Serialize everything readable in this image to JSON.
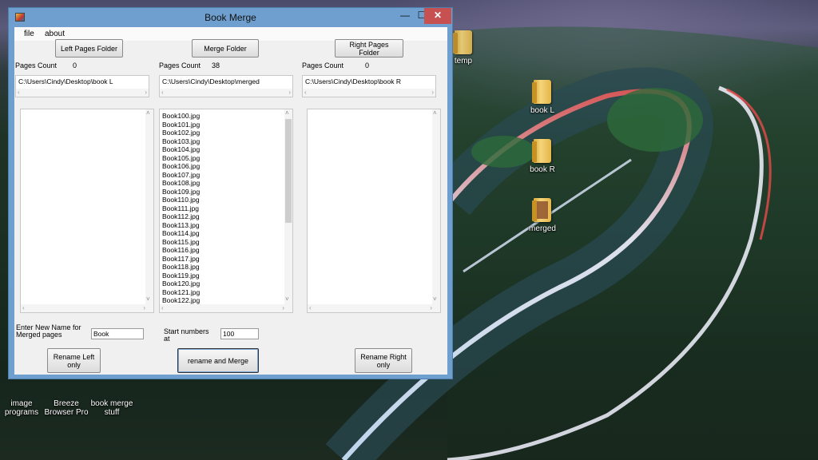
{
  "window": {
    "title": "Book Merge",
    "controls": {
      "minimize": "—",
      "maximize": "☐",
      "close": "✕"
    }
  },
  "menu": {
    "items": [
      "file",
      "about"
    ]
  },
  "buttons": {
    "left_folder": "Left Pages Folder",
    "merge_folder": "Merge Folder",
    "right_folder": "Right Pages Folder",
    "rename_left": "Rename Left only",
    "rename_merge": "rename and Merge",
    "rename_right": "Rename Right only"
  },
  "columns": {
    "left": {
      "count_label": "Pages Count",
      "count": "0",
      "path": "C:\\Users\\Cindy\\Desktop\\book L",
      "files": []
    },
    "merge": {
      "count_label": "Pages Count",
      "count": "38",
      "path": "C:\\Users\\Cindy\\Desktop\\merged",
      "files": [
        "Book100.jpg",
        "Book101.jpg",
        "Book102.jpg",
        "Book103.jpg",
        "Book104.jpg",
        "Book105.jpg",
        "Book106.jpg",
        "Book107.jpg",
        "Book108.jpg",
        "Book109.jpg",
        "Book110.jpg",
        "Book111.jpg",
        "Book112.jpg",
        "Book113.jpg",
        "Book114.jpg",
        "Book115.jpg",
        "Book116.jpg",
        "Book117.jpg",
        "Book118.jpg",
        "Book119.jpg",
        "Book120.jpg",
        "Book121.jpg",
        "Book122.jpg"
      ]
    },
    "right": {
      "count_label": "Pages Count",
      "count": "0",
      "path": "C:\\Users\\Cindy\\Desktop\\book R",
      "files": []
    }
  },
  "rename": {
    "name_label": "Enter New Name for Merged pages",
    "name_value": "Book",
    "start_label": "Start numbers at",
    "start_value": "100"
  },
  "desktop": {
    "icons": [
      {
        "label": "temp",
        "icon": "folder-icon"
      },
      {
        "label": "book L",
        "icon": "folder-icon"
      },
      {
        "label": "book R",
        "icon": "folder-icon"
      },
      {
        "label": "merged",
        "icon": "folder-icon"
      },
      {
        "label": "image programs",
        "icon": "app-icon"
      },
      {
        "label": "Breeze Browser Pro",
        "icon": "app-icon"
      },
      {
        "label": "book merge stuff",
        "icon": "app-icon"
      }
    ]
  },
  "colors": {
    "title_bar": "#6f9fce",
    "close_button": "#c75050",
    "client_bg": "#f0f0f0"
  }
}
